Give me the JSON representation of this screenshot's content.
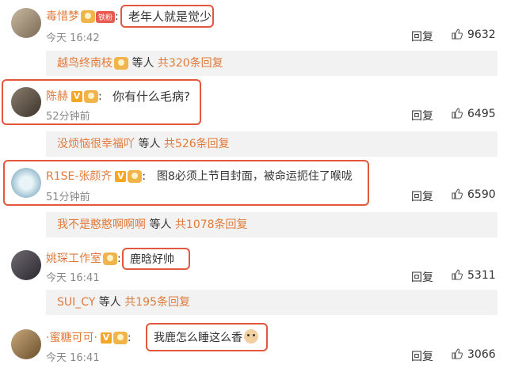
{
  "comments": [
    {
      "user": "毒惜梦",
      "badge": "铁粉",
      "text": "老年人就是觉少",
      "time": "今天 16:42",
      "reply": "回复",
      "likes": "9632",
      "sub": {
        "user": "越鸟终南枝",
        "mid": " 等人 ",
        "count": "共320条回复"
      }
    },
    {
      "user": "陈赫",
      "text": "你有什么毛病?",
      "time": "52分钟前",
      "reply": "回复",
      "likes": "6495",
      "sub": {
        "user": "没烦恼很幸福吖",
        "mid": " 等人 ",
        "count": "共526条回复"
      }
    },
    {
      "user": "R1SE-张颜齐",
      "text": "图8必须上节目封面，被命运扼住了喉咙",
      "time": "51分钟前",
      "reply": "回复",
      "likes": "6590",
      "sub": {
        "user": "我不是憨憨啊啊啊",
        "mid": " 等人 ",
        "count": "共1078条回复"
      }
    },
    {
      "user": "姚琛工作室",
      "text": "鹿晗好帅",
      "time": "今天 16:41",
      "reply": "回复",
      "likes": "5311",
      "sub": {
        "user": "SUI_CY",
        "mid": " 等人 ",
        "count": "共195条回复"
      }
    },
    {
      "user": "·蜜糖可可·",
      "text": "我鹿怎么睡这么香",
      "time": "今天 16:41",
      "reply": "回复",
      "likes": "3066"
    }
  ],
  "colors": {
    "accent": "#e07a3b",
    "highlight": "#e2583e"
  }
}
